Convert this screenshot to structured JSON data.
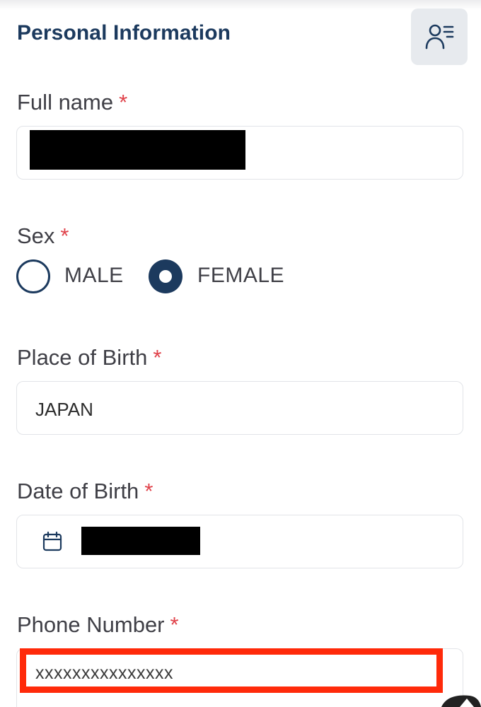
{
  "section": {
    "title": "Personal Information",
    "profile_icon": "person-list-icon"
  },
  "full_name": {
    "label": "Full name",
    "required_mark": "*",
    "value": ""
  },
  "sex": {
    "label": "Sex",
    "required_mark": "*",
    "options": [
      "MALE",
      "FEMALE"
    ],
    "selected": "FEMALE"
  },
  "place_of_birth": {
    "label": "Place of Birth",
    "required_mark": "*",
    "value": "JAPAN"
  },
  "date_of_birth": {
    "label": "Date of Birth",
    "required_mark": "*",
    "value": "",
    "icon": "calendar-icon"
  },
  "phone_number": {
    "label": "Phone Number",
    "required_mark": "*",
    "value": "xxxxxxxxxxxxxxx"
  },
  "colors": {
    "accent": "#1c3a5e",
    "required": "#e0424a",
    "highlight": "#ff2a0a",
    "border": "#e2e4e8"
  }
}
